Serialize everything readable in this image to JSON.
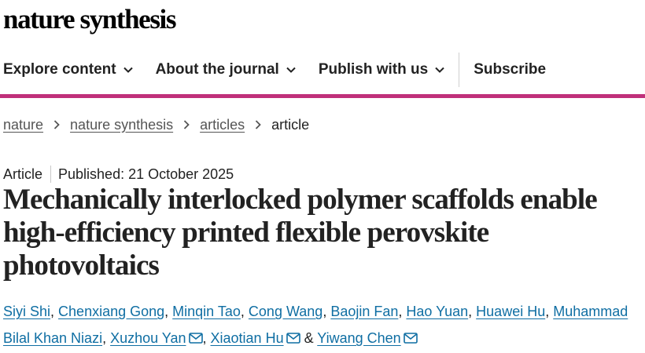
{
  "journal": {
    "logo_text": "nature synthesis"
  },
  "nav": {
    "items": [
      {
        "label": "Explore content",
        "has_dropdown": true
      },
      {
        "label": "About the journal",
        "has_dropdown": true
      },
      {
        "label": "Publish with us",
        "has_dropdown": true
      },
      {
        "label": "Subscribe",
        "has_dropdown": false
      }
    ]
  },
  "colors": {
    "accent_bar": "#c0307a",
    "author_link": "#0f6ea3"
  },
  "breadcrumb": {
    "items": [
      "nature",
      "nature synthesis",
      "articles"
    ],
    "current": "article"
  },
  "article": {
    "type": "Article",
    "published": "Published: 21 October 2025",
    "title": "Mechanically interlocked polymer scaffolds enable high-efficiency printed flexible perovskite photovoltaics",
    "authors": [
      {
        "name": "Siyi Shi",
        "email_icon": false
      },
      {
        "name": "Chenxiang Gong",
        "email_icon": false
      },
      {
        "name": "Minqin Tao",
        "email_icon": false
      },
      {
        "name": "Cong Wang",
        "email_icon": false
      },
      {
        "name": "Baojin Fan",
        "email_icon": false
      },
      {
        "name": "Hao Yuan",
        "email_icon": false
      },
      {
        "name": "Huawei Hu",
        "email_icon": false
      },
      {
        "name": "Muhammad Bilal Khan Niazi",
        "email_icon": false
      },
      {
        "name": "Xuzhou Yan",
        "email_icon": true
      },
      {
        "name": "Xiaotian Hu",
        "email_icon": true
      },
      {
        "name": "Yiwang Chen",
        "email_icon": true
      }
    ],
    "author_separator": ", ",
    "author_last_joiner": " & "
  }
}
